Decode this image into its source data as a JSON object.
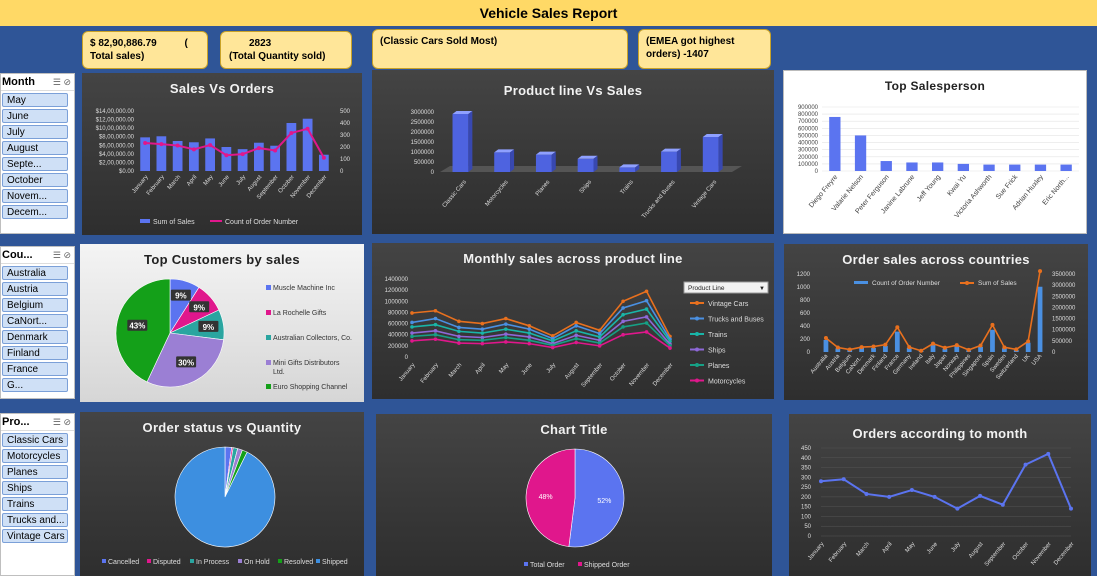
{
  "report_title": "Vehicle Sales Report",
  "kpis": [
    {
      "line1": "$ 82,90,886.79          (",
      "line2": "Total sales)"
    },
    {
      "line1": "2823",
      "line2": "(Total Quantity sold)"
    },
    {
      "line1": "(Classic Cars Sold Most)",
      "line2": ""
    },
    {
      "line1": "(EMEA got highest",
      "line2": "orders) -1407"
    }
  ],
  "slicers": {
    "month": {
      "header": "Month",
      "items": [
        "May",
        "June",
        "July",
        "August",
        "Septe...",
        "October",
        "Novem...",
        "Decem..."
      ]
    },
    "country": {
      "header": "Cou...",
      "items": [
        "Australia",
        "Austria",
        "Belgium",
        "CaNort...",
        "Denmark",
        "Finland",
        "France",
        "G..."
      ]
    },
    "product": {
      "header": "Pro...",
      "items": [
        "Classic Cars",
        "Motorcycles",
        "Planes",
        "Ships",
        "Trains",
        "Trucks and...",
        "Vintage Cars"
      ]
    }
  },
  "colors": {
    "accent_blue": "#5b74f0",
    "accent_pink": "#e0178c",
    "title_bar": "#ffd966",
    "background": "#2f5597"
  },
  "chart_data": [
    {
      "id": "sales_vs_orders",
      "type": "bar",
      "title": "Sales Vs Orders",
      "categories": [
        "January",
        "February",
        "March",
        "April",
        "May",
        "June",
        "July",
        "August",
        "September",
        "October",
        "November",
        "December"
      ],
      "series": [
        {
          "name": "Sum of Sales",
          "values": [
            785000,
            810000,
            700000,
            670000,
            760000,
            560000,
            510000,
            660000,
            590000,
            1120000,
            1220000,
            380000
          ]
        },
        {
          "name": "Count of Order Number",
          "values": [
            233,
            224,
            212,
            180,
            216,
            131,
            141,
            191,
            171,
            317,
            352,
            110
          ]
        }
      ],
      "y_ticks": [
        "$14,00,000.00",
        "$12,00,000.00",
        "$10,00,000.00",
        "$8,00,000.00",
        "$6,00,000.00",
        "$4,00,000.00",
        "$2,00,000.00",
        "$0.00"
      ],
      "y2_ticks": [
        "500",
        "400",
        "300",
        "200",
        "100",
        "0"
      ],
      "ylim": [
        0,
        1400000
      ],
      "y2lim": [
        0,
        500
      ]
    },
    {
      "id": "productline_vs_sales",
      "type": "bar",
      "title": "Product line Vs Sales",
      "categories": [
        "Classic Cars",
        "Motorcycles",
        "Planes",
        "Ships",
        "Trains",
        "Trucks and Buses",
        "Vintage Cars"
      ],
      "values": [
        2900000,
        980000,
        870000,
        660000,
        230000,
        1020000,
        1750000
      ],
      "y_ticks": [
        "3000000",
        "2500000",
        "2000000",
        "1500000",
        "1000000",
        "500000",
        "0"
      ],
      "ylim": [
        0,
        3000000
      ]
    },
    {
      "id": "top_salesperson",
      "type": "bar",
      "title": "Top Salesperson",
      "categories": [
        "Diego Freyre",
        "Valarie Nelson",
        "Peter Ferguson",
        "Janine Labrune",
        "Jeff Young",
        "Kwai Yu",
        "Victoria Ashworth",
        "Sue Frick",
        "Adrian Huxley",
        "Eric North..."
      ],
      "values": [
        760000,
        500000,
        140000,
        120000,
        120000,
        100000,
        90000,
        90000,
        90000,
        90000
      ],
      "y_ticks": [
        "900000",
        "800000",
        "700000",
        "600000",
        "500000",
        "400000",
        "300000",
        "200000",
        "100000",
        "0"
      ],
      "ylim": [
        0,
        900000
      ]
    },
    {
      "id": "top_customers",
      "type": "pie",
      "title": "Top Customers by sales",
      "series": [
        {
          "name": "Muscle Machine Inc",
          "value": 9,
          "color": "#5b74f0"
        },
        {
          "name": "La Rochelle Gifts",
          "value": 9,
          "color": "#e0178c"
        },
        {
          "name": "Australian Collectors, Co.",
          "value": 9,
          "color": "#2aa5a0"
        },
        {
          "name": "Mini Gifts Distributors Ltd.",
          "value": 30,
          "color": "#9b7fd4"
        },
        {
          "name": "Euro Shopping Channel",
          "value": 43,
          "color": "#14a019"
        }
      ],
      "labels": [
        "9%",
        "9%",
        "9%",
        "30%",
        "43%"
      ]
    },
    {
      "id": "monthly_sales_productline",
      "type": "line",
      "title": "Monthly sales across product line",
      "legend_title": "Product Line",
      "categories": [
        "January",
        "February",
        "March",
        "April",
        "May",
        "June",
        "July",
        "August",
        "September",
        "October",
        "November",
        "December"
      ],
      "series": [
        {
          "name": "Vintage Cars",
          "color": "#e8701e",
          "values": [
            790000,
            830000,
            640000,
            600000,
            690000,
            560000,
            380000,
            620000,
            480000,
            1000000,
            1180000,
            370000
          ]
        },
        {
          "name": "Trucks and Buses",
          "color": "#4a90e2",
          "values": [
            620000,
            690000,
            530000,
            500000,
            590000,
            500000,
            330000,
            560000,
            420000,
            880000,
            1010000,
            320000
          ]
        },
        {
          "name": "Trains",
          "color": "#19b5a8",
          "values": [
            540000,
            580000,
            460000,
            430000,
            500000,
            430000,
            290000,
            470000,
            360000,
            760000,
            860000,
            280000
          ]
        },
        {
          "name": "Ships",
          "color": "#8e68d8",
          "values": [
            430000,
            470000,
            370000,
            350000,
            410000,
            360000,
            240000,
            390000,
            300000,
            640000,
            720000,
            230000
          ]
        },
        {
          "name": "Planes",
          "color": "#16a085",
          "values": [
            370000,
            400000,
            310000,
            300000,
            350000,
            300000,
            210000,
            330000,
            250000,
            540000,
            610000,
            200000
          ]
        },
        {
          "name": "Motorcycles",
          "color": "#e0178c",
          "values": [
            290000,
            320000,
            250000,
            240000,
            270000,
            240000,
            170000,
            260000,
            200000,
            400000,
            450000,
            160000
          ]
        }
      ],
      "y_ticks": [
        "1400000",
        "1200000",
        "1000000",
        "800000",
        "600000",
        "400000",
        "200000",
        "0"
      ],
      "ylim": [
        0,
        1400000
      ]
    },
    {
      "id": "country_sales",
      "type": "bar",
      "title": "Order sales across countries",
      "categories": [
        "Australia",
        "Austria",
        "Belgium",
        "CaNort...",
        "Denmark",
        "Finland",
        "France",
        "Germany",
        "Ireland",
        "Italy",
        "Japan",
        "Norway",
        "Philippines",
        "Singapore",
        "Spain",
        "Sweden",
        "Switzerland",
        "UK",
        "USA"
      ],
      "series": [
        {
          "name": "Count of Order Number",
          "values": [
            185,
            55,
            33,
            70,
            63,
            92,
            314,
            62,
            16,
            113,
            52,
            85,
            26,
            79,
            342,
            57,
            31,
            144,
            1004
          ]
        },
        {
          "name": "Sum of Sales",
          "values": [
            630000,
            200000,
            110000,
            220000,
            245000,
            330000,
            1110000,
            220000,
            58000,
            375000,
            190000,
            307000,
            94000,
            290000,
            1215000,
            210000,
            117000,
            478000,
            3627000
          ]
        }
      ],
      "y_ticks": [
        "1200",
        "1000",
        "800",
        "600",
        "400",
        "200",
        "0"
      ],
      "y2_ticks": [
        "3500000",
        "3000000",
        "2500000",
        "2000000",
        "1500000",
        "1000000",
        "500000",
        "0"
      ],
      "ylim": [
        0,
        1200
      ],
      "y2lim": [
        0,
        3500000
      ]
    },
    {
      "id": "order_status_qty",
      "type": "pie",
      "title": "Order status vs Quantity",
      "series": [
        {
          "name": "Cancelled",
          "value": 60,
          "color": "#5b74f0"
        },
        {
          "name": "Disputed",
          "value": 14,
          "color": "#e0178c"
        },
        {
          "name": "In Process",
          "value": 41,
          "color": "#2aa5a0"
        },
        {
          "name": "On Hold",
          "value": 44,
          "color": "#9b7fd4"
        },
        {
          "name": "Resolved",
          "value": 47,
          "color": "#14a019"
        },
        {
          "name": "Shipped",
          "value": 2617,
          "color": "#3d8fe0"
        }
      ]
    },
    {
      "id": "total_vs_shipped",
      "type": "pie",
      "title": "Chart Title",
      "series": [
        {
          "name": "Total Order",
          "value": 52,
          "color": "#5b74f0"
        },
        {
          "name": "Shipped Order",
          "value": 48,
          "color": "#e0178c"
        }
      ],
      "labels": [
        "52%",
        "48%"
      ]
    },
    {
      "id": "orders_by_month",
      "type": "line",
      "title": "Orders according to month",
      "categories": [
        "January",
        "February",
        "March",
        "April",
        "May",
        "June",
        "July",
        "August",
        "September",
        "October",
        "November",
        "December"
      ],
      "values": [
        280,
        290,
        215,
        200,
        235,
        200,
        140,
        205,
        160,
        365,
        420,
        140
      ],
      "y_ticks": [
        "450",
        "400",
        "350",
        "300",
        "250",
        "200",
        "150",
        "100",
        "50",
        "0"
      ],
      "ylim": [
        0,
        450
      ]
    }
  ]
}
